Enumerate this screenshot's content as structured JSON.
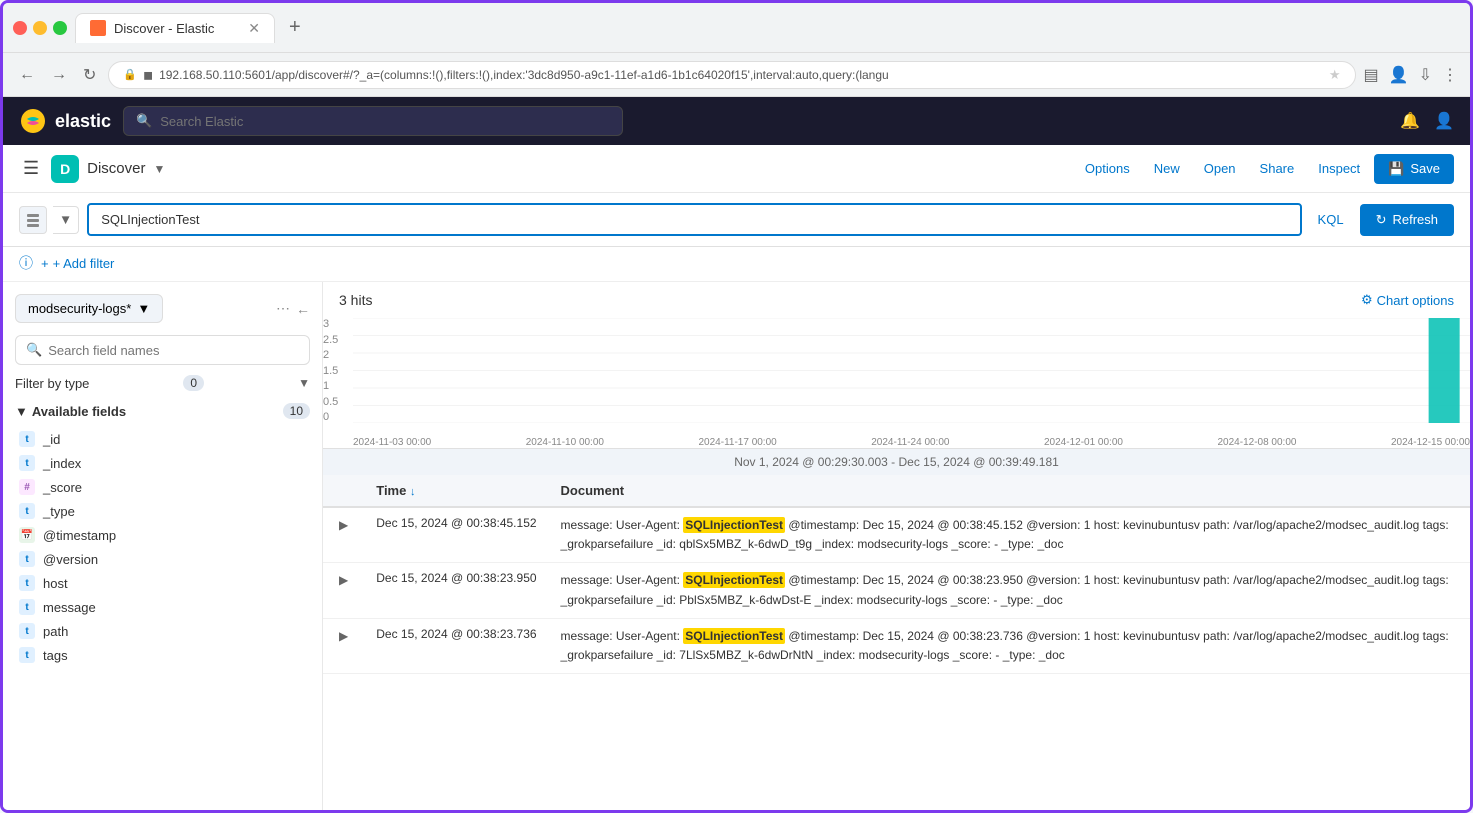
{
  "browser": {
    "tab_title": "Discover - Elastic",
    "tab_favicon": "E",
    "address_bar": "192.168.50.110:5601/app/discover#/?_a=(columns:!(),filters:!(),index:'3dc8d950-a9c1-11ef-a1d6-1b1c64020f15',interval:auto,query:(langu"
  },
  "app": {
    "logo_text": "elastic",
    "search_placeholder": "Search Elastic"
  },
  "nav": {
    "app_badge": "D",
    "app_name": "Discover",
    "options_label": "Options",
    "new_label": "New",
    "open_label": "Open",
    "share_label": "Share",
    "inspect_label": "Inspect",
    "save_label": "Save"
  },
  "toolbar": {
    "query_value": "SQLInjectionTest",
    "kql_label": "KQL",
    "refresh_label": "Refresh",
    "add_filter_label": "+ Add filter"
  },
  "sidebar": {
    "index_name": "modsecurity-logs*",
    "search_placeholder": "Search field names",
    "filter_type_label": "Filter by type",
    "filter_badge": "0",
    "available_fields_label": "Available fields",
    "available_fields_count": "10",
    "fields": [
      {
        "type": "t",
        "name": "_id"
      },
      {
        "type": "t",
        "name": "_index"
      },
      {
        "type": "hash",
        "name": "_score"
      },
      {
        "type": "t",
        "name": "_type"
      },
      {
        "type": "cal",
        "name": "@timestamp"
      },
      {
        "type": "t",
        "name": "@version"
      },
      {
        "type": "t",
        "name": "host"
      },
      {
        "type": "t",
        "name": "message"
      },
      {
        "type": "t",
        "name": "path"
      },
      {
        "type": "t",
        "name": "tags"
      }
    ]
  },
  "results": {
    "hits_label": "3 hits",
    "chart_options_label": "Chart options",
    "time_range": "Nov 1, 2024 @ 00:29:30.003 - Dec 15, 2024 @ 00:39:49.181",
    "chart": {
      "y_labels": [
        "3",
        "2.5",
        "2",
        "1.5",
        "1",
        "0.5",
        "0"
      ],
      "x_labels": [
        "2024-11-03 00:00",
        "2024-11-10 00:00",
        "2024-11-17 00:00",
        "2024-11-24 00:00",
        "2024-12-01 00:00",
        "2024-12-08 00:00",
        "2024-12-15 00:00"
      ]
    },
    "table": {
      "col_time": "Time",
      "col_document": "Document",
      "rows": [
        {
          "time": "Dec 15, 2024 @ 00:38:45.152",
          "doc_prefix": "message: User-Agent: ",
          "doc_highlight": "SQLInjectionTest",
          "doc_suffix": " @timestamp: Dec 15, 2024 @ 00:38:45.152 @version: 1 host: kevinubuntusv path: /var/log/apache2/modsec_audit.log tags: _grokparsefailure _id: qblSx5MBZ_k-6dwD_t9g _index: modsecurity-logs _score: - _type: _doc"
        },
        {
          "time": "Dec 15, 2024 @ 00:38:23.950",
          "doc_prefix": "message: User-Agent: ",
          "doc_highlight": "SQLInjectionTest",
          "doc_suffix": " @timestamp: Dec 15, 2024 @ 00:38:23.950 @version: 1 host: kevinubuntusv path: /var/log/apache2/modsec_audit.log tags: _grokparsefailure _id: PblSx5MBZ_k-6dwDst-E _index: modsecurity-logs _score: - _type: _doc"
        },
        {
          "time": "Dec 15, 2024 @ 00:38:23.736",
          "doc_prefix": "message: User-Agent: ",
          "doc_highlight": "SQLInjectionTest",
          "doc_suffix": " @timestamp: Dec 15, 2024 @ 00:38:23.736 @version: 1 host: kevinubuntusv path: /var/log/apache2/modsec_audit.log tags: _grokparsefailure _id: 7LlSx5MBZ_k-6dwDrNtN _index: modsecurity-logs _score: - _type: _doc"
        }
      ]
    }
  }
}
